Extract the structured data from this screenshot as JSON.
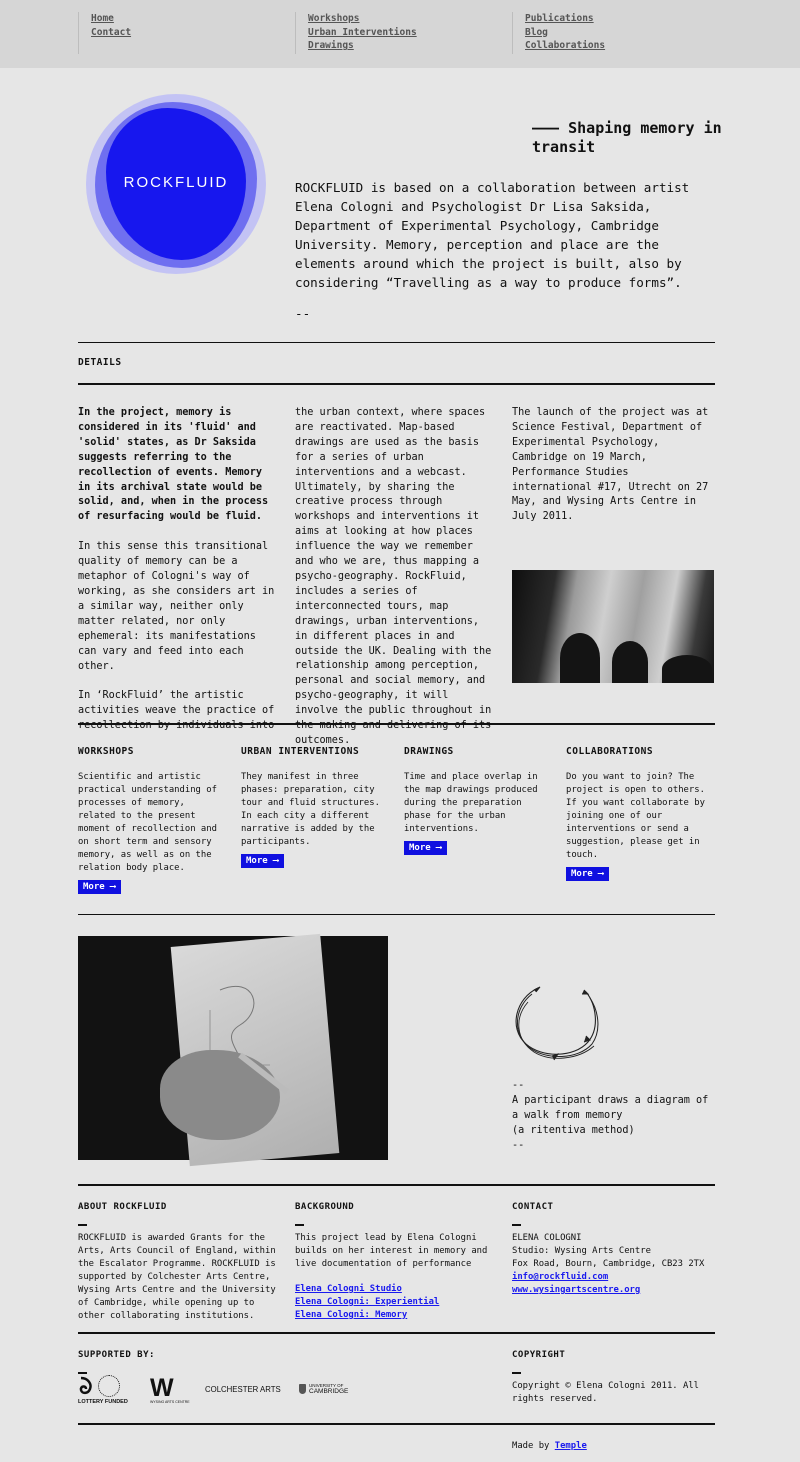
{
  "nav": {
    "col1": [
      "Home",
      "Contact"
    ],
    "col2": [
      "Workshops",
      "Urban Interventions",
      "Drawings"
    ],
    "col3": [
      "Publications",
      "Blog",
      "Collaborations"
    ]
  },
  "hero": {
    "logo_text": "ROCKFLUID",
    "tagline_dash": "———",
    "tagline": "Shaping memory in transit",
    "intro": "ROCKFLUID is based on a collaboration between artist Elena Cologni and Psychologist Dr Lisa Saksida, Department of Experimental Psychology, Cambridge University. Memory, perception and place are the elements around which the project is built, also by considering “Travelling as a way to produce forms”.",
    "intro_dash": "--"
  },
  "details": {
    "heading": "DETAILS",
    "col1_bold": "In the project, memory is considered in its 'fluid' and 'solid' states, as Dr Saksida suggests referring to the recollection of events. Memory in its archival state would be solid, and, when in the process of resurfacing would be fluid.",
    "col1_p2": "In this sense this transitional quality of memory can be a metaphor of Cologni's way of working, as she considers art in a similar way, neither only matter related, nor only ephemeral: its manifestations can vary and feed into each other.",
    "col1_p3": "In ‘RockFluid’ the artistic activities weave the practice of recollection by individuals into",
    "col2": "the urban context, where spaces are reactivated. Map-based drawings are used as the basis for a series of urban interventions and a webcast. Ultimately, by sharing the creative process through workshops and interventions it aims at looking at how places influence the way we remember and who we are, thus mapping a psycho-geography. RockFluid, includes a series of interconnected tours, map drawings, urban interventions, in different places in and outside the UK. Dealing with the relationship among perception, personal and social memory, and psycho-geography, it will involve the public throughout in the making and delivering of its outcomes.",
    "col3": "The launch of the project was at Science Festival, Department of Experimental Psychology, Cambridge on 19 March, Performance Studies international #17, Utrecht on 27 May, and Wysing Arts Centre in July 2011."
  },
  "features": [
    {
      "title": "WORKSHOPS",
      "text": "Scientific and artistic practical understanding of processes of memory, related to the present moment of recollection and on short term and sensory memory, as well as on the relation body place.",
      "more": "More ⟶"
    },
    {
      "title": "URBAN INTERVENTIONS",
      "text": "They manifest in three phases: preparation, city tour and fluid structures. In each city a different narrative is added by the participants.",
      "more": "More ⟶"
    },
    {
      "title": "DRAWINGS",
      "text": "Time and place overlap in the map drawings produced during the preparation phase for the urban interventions.",
      "more": "More ⟶"
    },
    {
      "title": "COLLABORATIONS",
      "text": "Do you want to join? The project is open to others. If you want collaborate by joining one of our interventions or send a suggestion, please get in touch.",
      "more": "More ⟶"
    }
  ],
  "caption": {
    "dash_top": "--",
    "text": "A participant draws a diagram of a walk from memory",
    "method": "(a ritentiva method)",
    "dash_bottom": "--"
  },
  "footer": {
    "about": {
      "heading": "ABOUT ROCKFLUID",
      "text": "ROCKFLUID is awarded Grants for the Arts, Arts Council of England, within the Escalator Programme. ROCKFLUID is supported by Colchester Arts Centre, Wysing Arts Centre and the University of Cambridge, while opening up to other collaborating institutions."
    },
    "background": {
      "heading": "BACKGROUND",
      "text": "This project lead by Elena Cologni builds on her interest in memory and live documentation of performance",
      "links": [
        "Elena Cologni Studio",
        "Elena Cologni: Experiential",
        "Elena Cologni: Memory"
      ]
    },
    "contact": {
      "heading": "CONTACT",
      "name": "ELENA COLOGNI",
      "studio": "Studio: Wysing Arts Centre",
      "address": "Fox Road, Bourn, Cambridge, CB23 2TX",
      "email": "info@rockfluid.com",
      "site": "www.wysingartscentre.org"
    },
    "supported": {
      "heading": "SUPPORTED BY:",
      "lottery": "LOTTERY FUNDED",
      "arts_council": "ARTS COUNCIL ENGLAND",
      "wysing": "W",
      "wysing_small": "WYSING ARTS CENTRE",
      "colchester": "COLCHESTER ARTS",
      "cambridge_top": "UNIVERSITY OF",
      "cambridge": "CAMBRIDGE"
    },
    "copyright": {
      "heading": "COPYRIGHT",
      "text": "Copyright © Elena Cologni 2011. All rights reserved."
    },
    "made_by": "Made by",
    "made_by_link": "Temple"
  },
  "colors": {
    "accent": "#1010e0",
    "logo_outer": "#c3c3f4",
    "logo_mid": "#6f6ff0",
    "logo_core": "#1717ee",
    "background": "#e6e6e6",
    "nav": "#d6d6d6"
  }
}
